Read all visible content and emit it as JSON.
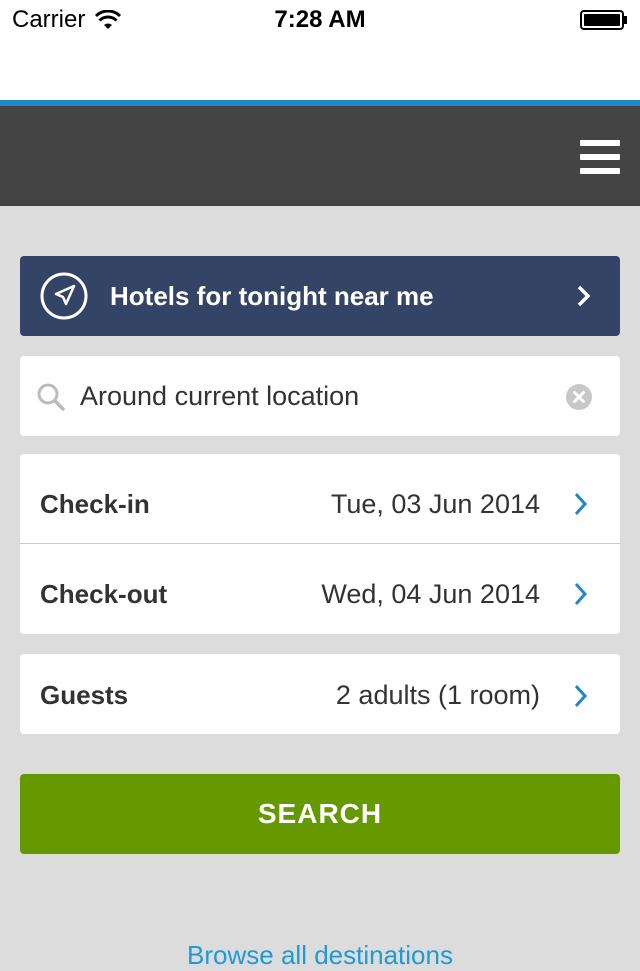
{
  "status_bar": {
    "carrier": "Carrier",
    "time": "7:28 AM"
  },
  "colors": {
    "accent_line": "#1e88c8",
    "nav_bg": "#444444",
    "nearme_bg": "#334466",
    "search_button_bg": "#669900",
    "link": "#1e9ad6",
    "chevron": "#1e88c8"
  },
  "nav": {
    "menu_icon": "hamburger-menu-icon"
  },
  "nearme": {
    "label": "Hotels for tonight near me",
    "icon": "location-arrow-icon"
  },
  "search": {
    "value": "Around current location",
    "placeholder": "Around current location"
  },
  "dates": {
    "checkin_label": "Check-in",
    "checkin_value": "Tue, 03 Jun 2014",
    "checkout_label": "Check-out",
    "checkout_value": "Wed, 04 Jun 2014"
  },
  "guests": {
    "label": "Guests",
    "value": "2 adults (1 room)"
  },
  "actions": {
    "search_label": "SEARCH",
    "browse_label": "Browse all destinations"
  }
}
